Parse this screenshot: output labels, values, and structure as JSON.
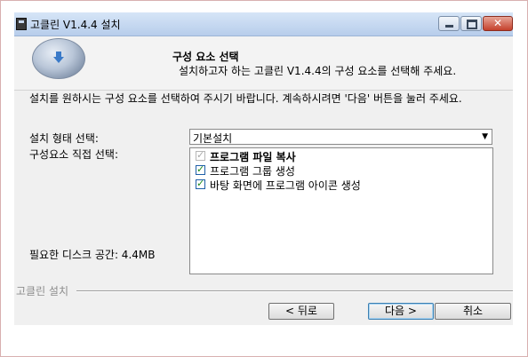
{
  "window": {
    "title": "고클린 V1.4.4 설치",
    "controls": {
      "minimize": "minimize-icon",
      "maximize": "maximize-icon",
      "close": "close-icon"
    }
  },
  "header": {
    "title": "구성 요소 선택",
    "subtitle": "설치하고자 하는 고클린 V1.4.4의 구성 요소를 선택해 주세요.",
    "logo_icon": "install-disc-icon"
  },
  "description": "설치를 원하시는 구성 요소를 선택하여 주시기 바랍니다. 계속하시려면 '다음' 버튼을 눌러 주세요.",
  "form": {
    "install_type_label": "설치 형태 선택:",
    "install_type_value": "기본설치",
    "components_label": "구성요소 직접 선택:",
    "components": [
      {
        "label": "프로그램 파일 복사",
        "checked": true,
        "disabled": true
      },
      {
        "label": "프로그램 그룹 생성",
        "checked": true,
        "disabled": false
      },
      {
        "label": "바탕 화면에 프로그램 아이콘 생성",
        "checked": true,
        "disabled": false
      }
    ],
    "disk_space_label": "필요한 디스크 공간: 4.4MB"
  },
  "footer": {
    "brand": "고클린 설치",
    "back_label": "< 뒤로",
    "next_label": "다음 >",
    "cancel_label": "취소"
  }
}
